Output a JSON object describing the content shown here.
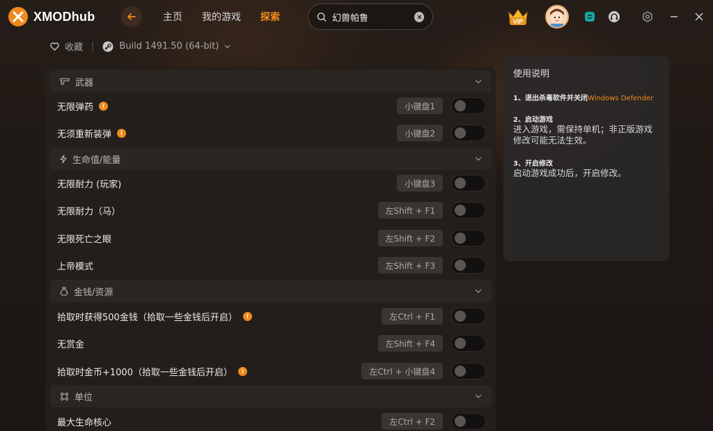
{
  "app": {
    "logo_text": "XMODhub"
  },
  "nav": {
    "items": [
      "主页",
      "我的游戏",
      "探索"
    ],
    "active": "探索"
  },
  "search": {
    "value": "幻兽帕鲁",
    "placeholder": ""
  },
  "vip": {
    "label": "VIP"
  },
  "subbar": {
    "favorite_label": "收藏",
    "build_label": "Build 1491.50 (64-bit)"
  },
  "sections": [
    {
      "title": "武器",
      "icon": "gun-icon",
      "rows": [
        {
          "label": "无限弹药",
          "info": true,
          "key": "小键盘1",
          "enabled": false
        },
        {
          "label": "无须重新装弹",
          "info": true,
          "key": "小键盘2",
          "enabled": false
        }
      ]
    },
    {
      "title": "生命值/能量",
      "icon": "lightning-icon",
      "rows": [
        {
          "label": "无限耐力 (玩家)",
          "info": false,
          "key": "小键盘3",
          "enabled": false
        },
        {
          "label": "无限耐力（马）",
          "info": false,
          "key": "左Shift + F1",
          "enabled": false
        },
        {
          "label": "无限死亡之眼",
          "info": false,
          "key": "左Shift + F2",
          "enabled": false
        },
        {
          "label": "上帝模式",
          "info": false,
          "key": "左Shift + F3",
          "enabled": false
        }
      ]
    },
    {
      "title": "金钱/资源",
      "icon": "money-bag-icon",
      "rows": [
        {
          "label": "拾取时获得500金钱（拾取一些金钱后开启）",
          "info": true,
          "key": "左Ctrl + F1",
          "enabled": false
        },
        {
          "label": "无赏金",
          "info": false,
          "key": "左Shift + F4",
          "enabled": false
        },
        {
          "label": "拾取时金币+1000（拾取一些金钱后开启）",
          "info": true,
          "key": "左Ctrl + 小键盘4",
          "enabled": false
        }
      ]
    },
    {
      "title": "单位",
      "icon": "unit-icon",
      "rows": [
        {
          "label": "最大生命核心",
          "info": false,
          "key": "左Ctrl + F2",
          "enabled": false
        }
      ]
    }
  ],
  "help": {
    "title": "使用说明",
    "steps": [
      {
        "heading": "1、退出杀毒软件并关闭",
        "highlight": "Windows Defender",
        "body": ""
      },
      {
        "heading": "2、启动游戏",
        "highlight": "",
        "body": "进入游戏，需保持单机；非正版游戏修改可能无法生效。"
      },
      {
        "heading": "3、开启修改",
        "highlight": "",
        "body": "启动游戏成功后，开启修改。"
      }
    ]
  },
  "colors": {
    "accent": "#f08a1c",
    "background": "#1d1714",
    "panel": "#241f1c"
  }
}
